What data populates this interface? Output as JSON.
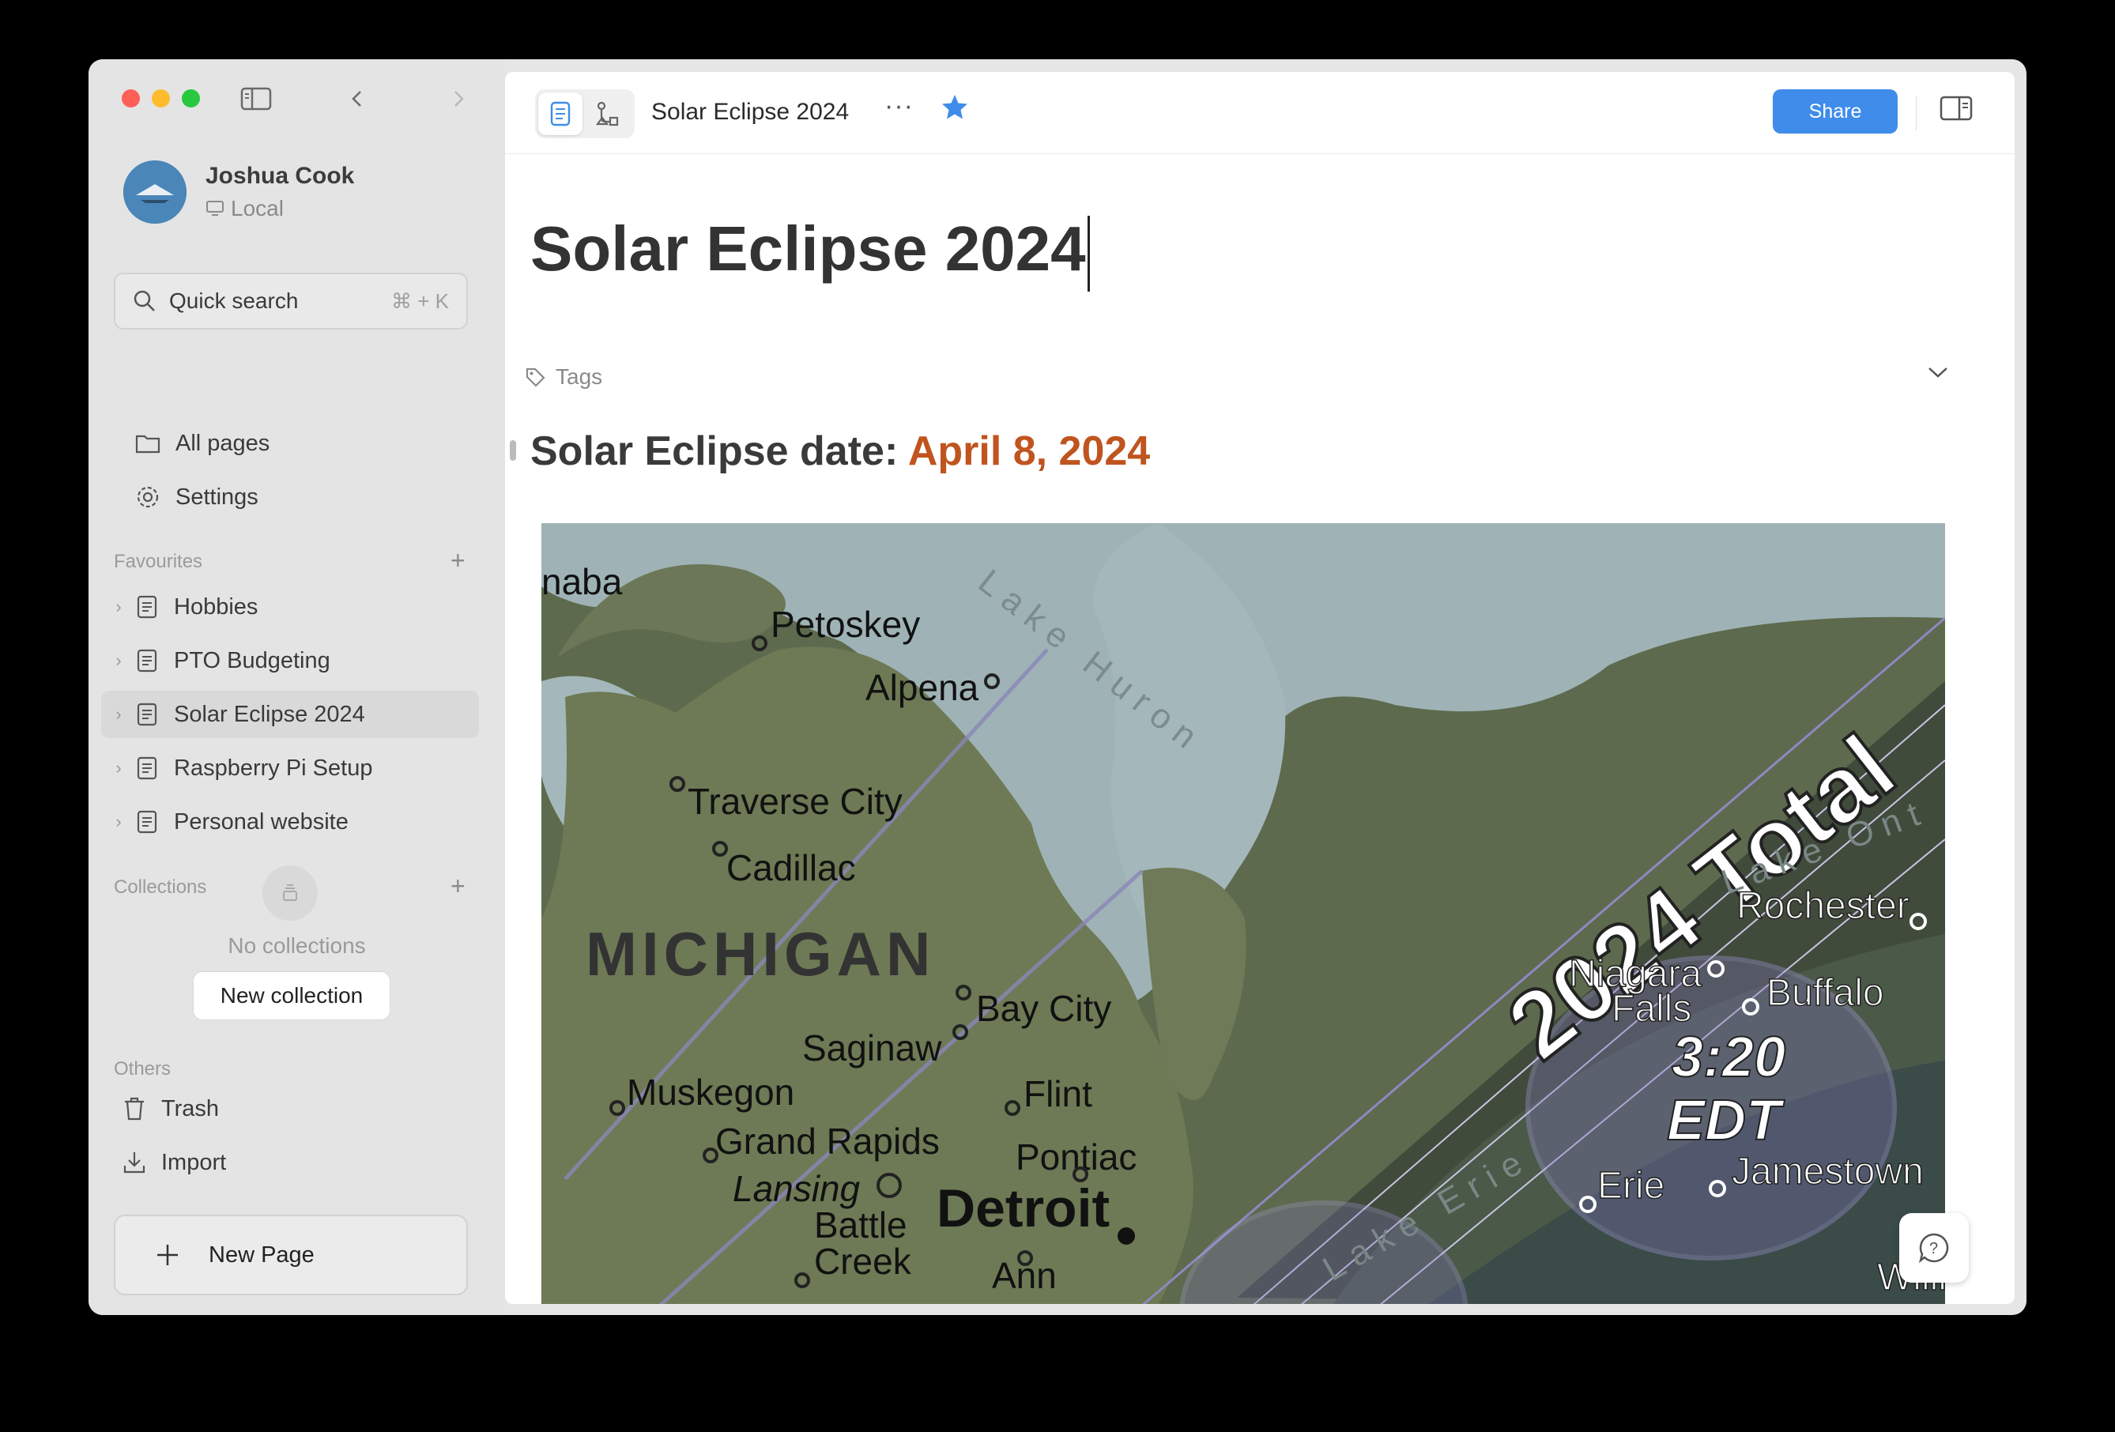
{
  "sidebar": {
    "user": {
      "name": "Joshua Cook",
      "workspace": "Local"
    },
    "search": {
      "label": "Quick search",
      "shortcut": "⌘ + K"
    },
    "nav": [
      {
        "label": "All pages",
        "icon": "folder-icon"
      },
      {
        "label": "Settings",
        "icon": "gear-icon"
      }
    ],
    "favourites": {
      "title": "Favourites",
      "items": [
        {
          "label": "Hobbies"
        },
        {
          "label": "PTO Budgeting"
        },
        {
          "label": "Solar Eclipse 2024",
          "active": true
        },
        {
          "label": "Raspberry Pi Setup"
        },
        {
          "label": "Personal website"
        }
      ]
    },
    "collections": {
      "title": "Collections",
      "empty_text": "No collections",
      "new_button": "New collection"
    },
    "others": {
      "title": "Others",
      "items": [
        {
          "label": "Trash",
          "icon": "trash-icon"
        },
        {
          "label": "Import",
          "icon": "import-icon"
        }
      ]
    },
    "new_page": "New Page"
  },
  "toolbar": {
    "title": "Solar Eclipse 2024",
    "more": "···",
    "share": "Share"
  },
  "document": {
    "title": "Solar Eclipse 2024",
    "tags_label": "Tags",
    "heading_prefix": "Solar Eclipse date: ",
    "heading_date": "April 8, 2024",
    "map": {
      "banner": "2024 Total",
      "time": "3:20",
      "timezone": "EDT",
      "state": "MICHIGAN",
      "lakes": [
        "Lake Huron",
        "Lake Erie",
        "Lake Ont"
      ],
      "cities": [
        "naba",
        "Petoskey",
        "Alpena",
        "Traverse City",
        "Cadillac",
        "Bay City",
        "Saginaw",
        "Muskegon",
        "Flint",
        "Grand Rapids",
        "Pontiac",
        "Lansing",
        "Battle",
        "Creek",
        "Detroit",
        "Ann",
        "Rochester",
        "Niagara",
        "Falls",
        "Buffalo",
        "Erie",
        "Jamestown",
        "Willi"
      ]
    }
  },
  "colors": {
    "accent": "#3f8cea",
    "date": "#c0541f",
    "sidebar_bg": "#e4e4e4"
  }
}
